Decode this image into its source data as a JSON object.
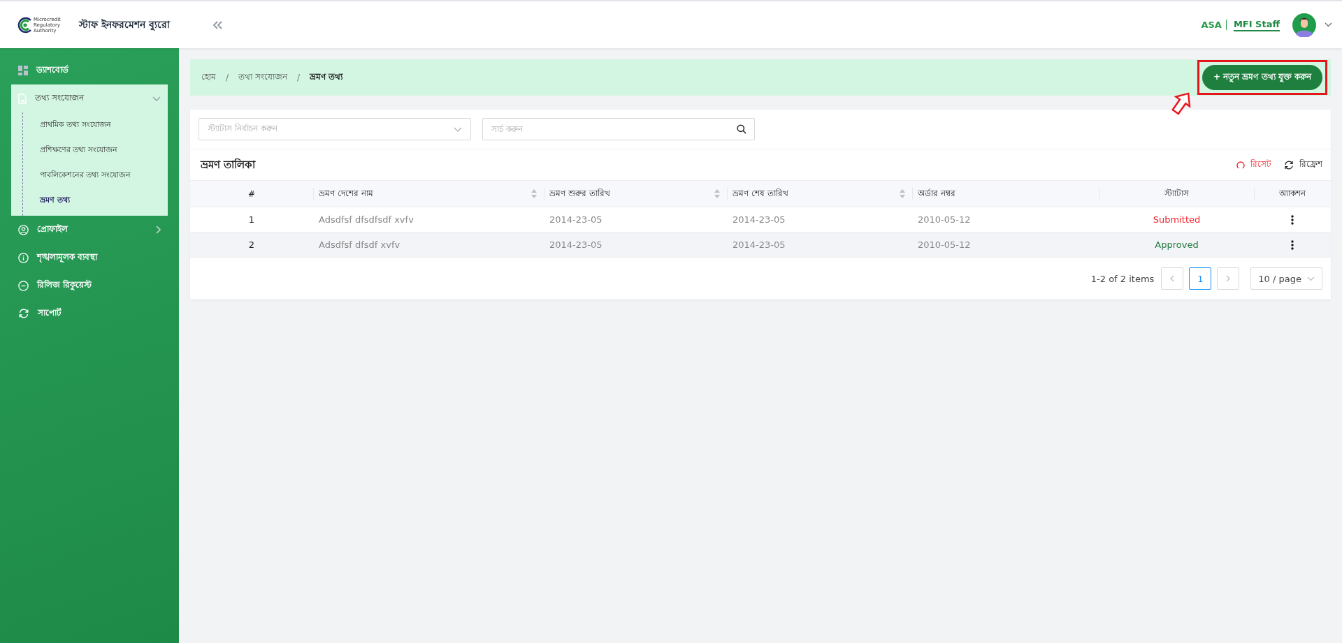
{
  "header": {
    "logo_lines": [
      "Microcredit",
      "Regulatory",
      "Authority"
    ],
    "app_title": "স্টাফ ইনফরমেশন ব্যুরো",
    "org": "ASA",
    "role": "MFI Staff"
  },
  "sidebar": {
    "items": [
      {
        "label": "ড্যাশবোর্ড",
        "kind": "grid"
      },
      {
        "label": "তথ্য সংযোজন",
        "kind": "document",
        "expanded": true,
        "children": [
          {
            "label": "প্রাথমিক তথ্য সংযোজন",
            "selected": false
          },
          {
            "label": "প্রশিক্ষণের তথ্য সংযোজন",
            "selected": false
          },
          {
            "label": "পাবলিকেশনের তথ্য সংযোজন",
            "selected": false
          },
          {
            "label": "ভ্রমণ তথ্য",
            "selected": true
          }
        ]
      },
      {
        "label": "প্রোফাইল",
        "kind": "user",
        "expanded": false
      },
      {
        "label": "শৃঙ্খলামূলক ব্যবস্থা",
        "kind": "info"
      },
      {
        "label": "রিলিজ রিকুয়েস্ট",
        "kind": "minus"
      },
      {
        "label": "সাপোর্ট",
        "kind": "sync"
      }
    ]
  },
  "breadcrumb": {
    "separator": "/",
    "items": [
      "হোম",
      "তথ্য সংযোজন",
      "ভ্রমণ তথ্য"
    ]
  },
  "add_button": {
    "label": "+ নতুন ভ্রমণ তথ্য যুক্ত করুন",
    "highlighted": true
  },
  "filters": {
    "status_placeholder": "স্ট্যাটাস নির্বাচন করুন",
    "search_placeholder": "সার্চ করুন"
  },
  "table": {
    "title": "ভ্রমণ তালিকা",
    "actions": [
      {
        "label": "রিসেট",
        "kind": "reset"
      },
      {
        "label": "রিফ্রেশ",
        "kind": "refresh"
      }
    ],
    "columns": [
      {
        "label": "#",
        "sortable": false
      },
      {
        "label": "ভ্রমণ দেশের নাম",
        "sortable": true
      },
      {
        "label": "ভ্রমণ শুরুর তারিখ",
        "sortable": true
      },
      {
        "label": "ভ্রমণ শেষ তারিখ",
        "sortable": true
      },
      {
        "label": "অর্ডার নম্বর",
        "sortable": false
      },
      {
        "label": "স্ট্যাটাস",
        "sortable": false
      },
      {
        "label": "অ্যাকশন",
        "sortable": false
      }
    ],
    "rows": [
      {
        "cells": [
          "1",
          "Adsdfsf dfsdfsdf xvfv",
          "2014-23-05",
          "2014-23-05",
          "2010-05-12",
          "Submitted"
        ],
        "kind": "submitted",
        "highlighted": false
      },
      {
        "cells": [
          "2",
          "Adsdfsf dfsdf xvfv",
          "2014-23-05",
          "2014-23-05",
          "2010-05-12",
          "Approved"
        ],
        "kind": "approved",
        "highlighted": true
      }
    ]
  },
  "pagination": {
    "summary": "1-2 of 2 items",
    "pages": [
      {
        "label": "1",
        "selected": true
      }
    ],
    "page_size": "10 / page"
  }
}
